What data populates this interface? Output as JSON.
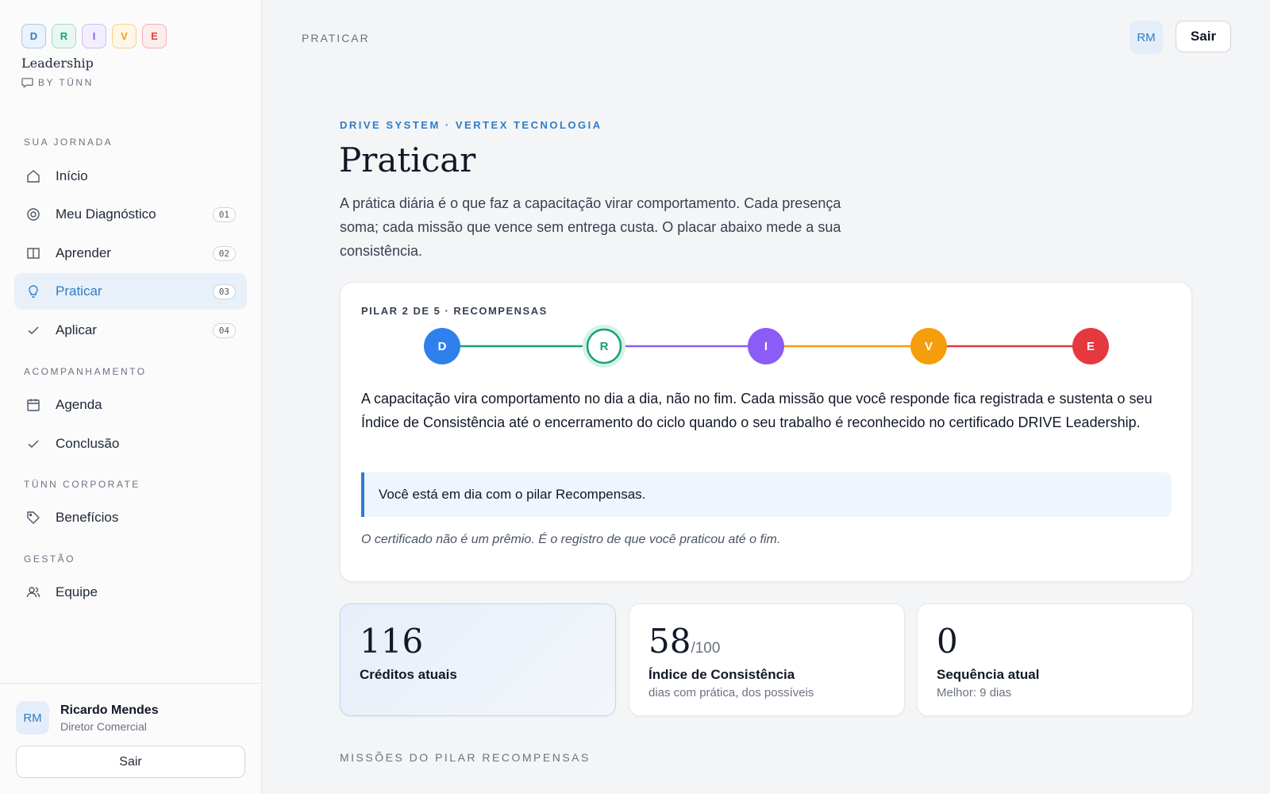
{
  "brand": {
    "letters": [
      {
        "char": "D",
        "color": "#2f7cc8",
        "bg": "#eaf2fc",
        "border": "#a9c9ec"
      },
      {
        "char": "R",
        "color": "#16a371",
        "bg": "#e8f7f0",
        "border": "#a6dcc5"
      },
      {
        "char": "I",
        "color": "#8b5cf6",
        "bg": "#f3eefe",
        "border": "#cdbcf7"
      },
      {
        "char": "V",
        "color": "#f59e0b",
        "bg": "#fef6e6",
        "border": "#f6d28d"
      },
      {
        "char": "E",
        "color": "#e0413f",
        "bg": "#fdecec",
        "border": "#f1b1b0"
      }
    ],
    "name": "Leadership",
    "by": "BY TÜNN"
  },
  "sidebar": {
    "sections": [
      {
        "title": "SUA JORNADA",
        "items": [
          {
            "label": "Início",
            "icon": "home-icon",
            "badge": ""
          },
          {
            "label": "Meu Diagnóstico",
            "icon": "target-icon",
            "badge": "01"
          },
          {
            "label": "Aprender",
            "icon": "book-icon",
            "badge": "02"
          },
          {
            "label": "Praticar",
            "icon": "lightbulb-icon",
            "badge": "03",
            "active": true
          },
          {
            "label": "Aplicar",
            "icon": "check-icon",
            "badge": "04"
          }
        ]
      },
      {
        "title": "ACOMPANHAMENTO",
        "items": [
          {
            "label": "Agenda",
            "icon": "calendar-icon",
            "badge": ""
          },
          {
            "label": "Conclusão",
            "icon": "check-icon",
            "badge": ""
          }
        ]
      },
      {
        "title": "TÜNN CORPORATE",
        "items": [
          {
            "label": "Benefícios",
            "icon": "tag-icon",
            "badge": ""
          }
        ]
      },
      {
        "title": "GESTÃO",
        "items": [
          {
            "label": "Equipe",
            "icon": "users-icon",
            "badge": ""
          }
        ]
      }
    ],
    "user": {
      "initials": "RM",
      "name": "Ricardo Mendes",
      "role": "Diretor Comercial"
    },
    "logout_label": "Sair"
  },
  "topbar": {
    "crumb": "PRATICAR",
    "initials": "RM",
    "logout_label": "Sair"
  },
  "main": {
    "eyebrow": "DRIVE SYSTEM · VERTEX TECNOLOGIA",
    "title": "Praticar",
    "intro": "A prática diária é o que faz a capacitação virar comportamento. Cada presença soma; cada missão que vence sem entrega custa. O placar abaixo mede a sua consistência.",
    "pillar": {
      "label": "PILAR 2 DE 5 · RECOMPENSAS",
      "steps": [
        {
          "char": "D",
          "color": "#2f80ed"
        },
        {
          "char": "R",
          "color": "#16a371",
          "current": true
        },
        {
          "char": "I",
          "color": "#8b5cf6"
        },
        {
          "char": "V",
          "color": "#f59e0b"
        },
        {
          "char": "E",
          "color": "#e5393f"
        }
      ],
      "text": "A capacitação vira comportamento no dia a dia, não no fim. Cada missão que você responde fica registrada e sustenta o seu Índice de Consistência até o encerramento do ciclo quando o seu trabalho é reconhecido no certificado DRIVE Leadership.",
      "callout": "Você está em dia com o pilar Recompensas.",
      "footnote": "O certificado não é um prêmio. É o registro de que você praticou até o fim."
    },
    "stats": [
      {
        "value": "116",
        "suffix": "",
        "label": "Créditos atuais",
        "sub": "",
        "highlight": true
      },
      {
        "value": "58",
        "suffix": "/100",
        "label": "Índice de Consistência",
        "sub": "dias com prática, dos possíveis"
      },
      {
        "value": "0",
        "suffix": "",
        "label": "Sequência atual",
        "sub": "Melhor: 9 dias"
      }
    ],
    "missions_title": "MISSÕES DO PILAR RECOMPENSAS"
  }
}
